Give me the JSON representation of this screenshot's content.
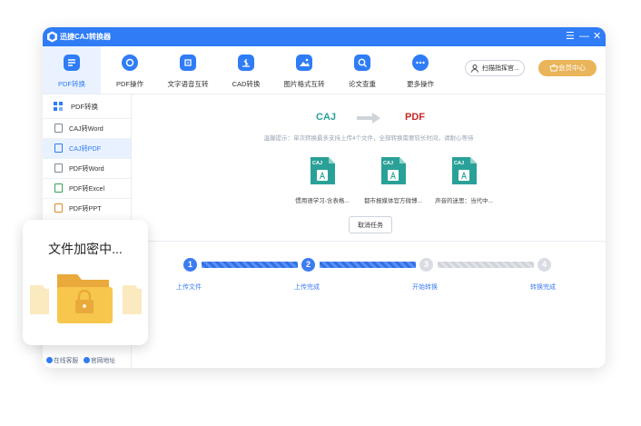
{
  "app": {
    "title": "迅捷CAJ转换器",
    "controls": [
      "☰",
      "—",
      "✕"
    ]
  },
  "toolbar": {
    "tools": [
      {
        "label": "PDF转换",
        "icon": "pdf-convert-icon",
        "active": true
      },
      {
        "label": "PDF操作",
        "icon": "pdf-operate-icon",
        "active": false
      },
      {
        "label": "文字语音互转",
        "icon": "text-voice-icon",
        "active": false
      },
      {
        "label": "CAD转换",
        "icon": "cad-icon",
        "active": false
      },
      {
        "label": "图片格式互转",
        "icon": "image-icon",
        "active": false
      },
      {
        "label": "论文查重",
        "icon": "paper-check-icon",
        "active": false
      },
      {
        "label": "更多操作",
        "icon": "more-icon",
        "active": false
      }
    ],
    "scan_label": "扫描指挥官...",
    "vip_label": "会员中心"
  },
  "sidebar": {
    "header": "PDF转换",
    "items": [
      {
        "label": "CAJ转Word",
        "selected": false
      },
      {
        "label": "CAJ转PDF",
        "selected": true
      },
      {
        "label": "PDF转Word",
        "selected": false
      },
      {
        "label": "PDF转Excel",
        "selected": false
      },
      {
        "label": "PDF转PPT",
        "selected": false
      }
    ],
    "footer_service": "在线客服",
    "footer_site": "官网地址"
  },
  "main": {
    "from_format": "CAJ",
    "to_format": "PDF",
    "tip": "温馨提示：单次转换最多支持上传4个文件，全部转换需要较长时间，请耐心等待",
    "files": [
      {
        "name": "惯用语学习-含表格...",
        "badge": "CAJ"
      },
      {
        "name": "都市报媒体官方微博...",
        "badge": "CAJ"
      },
      {
        "name": "声音的迷思：当代中...",
        "badge": "CAJ"
      }
    ],
    "cancel_label": "取消任务",
    "steps": [
      {
        "num": "1",
        "label": "上传文件",
        "done": true
      },
      {
        "num": "2",
        "label": "上传完成",
        "done": true
      },
      {
        "num": "3",
        "label": "开始转换",
        "done": false
      },
      {
        "num": "4",
        "label": "转换完成",
        "done": false
      }
    ]
  },
  "popup": {
    "title": "文件加密中..."
  },
  "colors": {
    "brand": "#2f7cf6",
    "vip": "#e9b45a",
    "caj": "#2aa198",
    "pdf": "#c62828"
  }
}
